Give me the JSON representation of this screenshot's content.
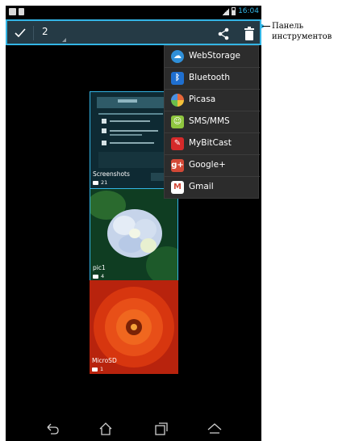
{
  "status_bar": {
    "time": "16:04",
    "icons": [
      "screenshot-icon",
      "document-icon",
      "signal-icon",
      "battery-icon"
    ]
  },
  "toolbar": {
    "selected_count": "2",
    "icons": [
      "checkmark-icon",
      "share-icon",
      "trash-icon"
    ]
  },
  "share_menu": {
    "items": [
      {
        "label": "WebStorage",
        "icon": "webstorage-icon",
        "color": "#2f8fd8"
      },
      {
        "label": "Bluetooth",
        "icon": "bluetooth-icon",
        "color": "#1f6fd0"
      },
      {
        "label": "Picasa",
        "icon": "picasa-icon",
        "color": "#e7673a"
      },
      {
        "label": "SMS/MMS",
        "icon": "sms-icon",
        "color": "#8fc63f"
      },
      {
        "label": "MyBitCast",
        "icon": "mybitcast-icon",
        "color": "#d52a2a"
      },
      {
        "label": "Google+",
        "icon": "googleplus-icon",
        "color": "#d34836"
      },
      {
        "label": "Gmail",
        "icon": "gmail-icon",
        "color": "#ffffff"
      }
    ]
  },
  "albums": [
    {
      "name": "Screenshots",
      "count": "21"
    },
    {
      "name": "pic1",
      "count": "4"
    },
    {
      "name": "MicroSD",
      "count": "1"
    }
  ],
  "navigation": {
    "icons": [
      "back-icon",
      "home-icon",
      "recent-apps-icon",
      "menu-up-icon"
    ]
  },
  "callout": {
    "line1": "Панель",
    "line2": "инструментов"
  },
  "colors": {
    "accent": "#33b5e5",
    "toolbar": "#253a45",
    "menu": "#2c2c2c"
  }
}
